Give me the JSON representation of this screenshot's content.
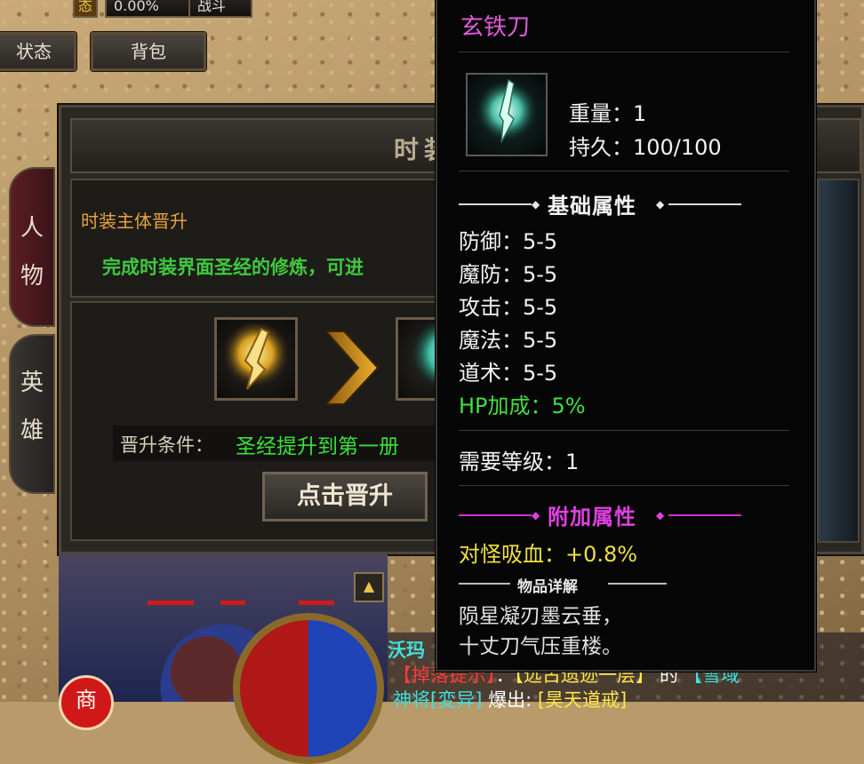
{
  "hud": {
    "percent": "0.00%",
    "mode": "战斗",
    "state_icon": "态",
    "btn_status": "状态",
    "btn_bag": "背包"
  },
  "panel": {
    "title": "时装",
    "tabs": [
      {
        "label": "人物",
        "chars": [
          "人",
          "物"
        ]
      },
      {
        "label": "英雄",
        "chars": [
          "英",
          "雄"
        ]
      }
    ],
    "section_title": "时装主体晋升",
    "description": "完成时装界面圣经的修炼，可进",
    "condition_label": "晋升条件：",
    "condition_value": "圣经提升到第一册",
    "upgrade_button": "点击晋升"
  },
  "tooltip": {
    "item_name": "玄铁刀",
    "weight": "重量：1",
    "durability": "持久：100/100",
    "basic_header": "基础属性",
    "stats": [
      {
        "label": "防御：5-5",
        "color": "#f2f2f2"
      },
      {
        "label": "魔防：5-5",
        "color": "#f2f2f2"
      },
      {
        "label": "攻击：5-5",
        "color": "#f2f2f2"
      },
      {
        "label": "魔法：5-5",
        "color": "#f2f2f2"
      },
      {
        "label": "道术：5-5",
        "color": "#f2f2f2"
      },
      {
        "label": "HP加成：5%",
        "color": "#3ee03e"
      }
    ],
    "required_level": "需要等级：1",
    "extra_header": "附加属性",
    "extra_stat": "对怪吸血：+0.8%",
    "detail_header": "物品详解",
    "poem_line1": "陨星凝刃墨云垂，",
    "poem_line2": "十丈刀气压重楼。",
    "colors": {
      "name": "#e05ad8",
      "extra_header": "#e040e0",
      "extra_stat": "#f0e040",
      "bonus": "#3ee03e"
    }
  },
  "chat": {
    "line1": "沃玛",
    "line2_parts": [
      "【掉落提示】",
      "：",
      "【远古遗迹一层】",
      "的",
      "【雪域"
    ],
    "line3_parts": [
      "神将[変异]",
      "爆出:",
      "[昊天道戒]"
    ]
  },
  "bottom": {
    "small_btn": "▲",
    "red_btn": "商"
  }
}
